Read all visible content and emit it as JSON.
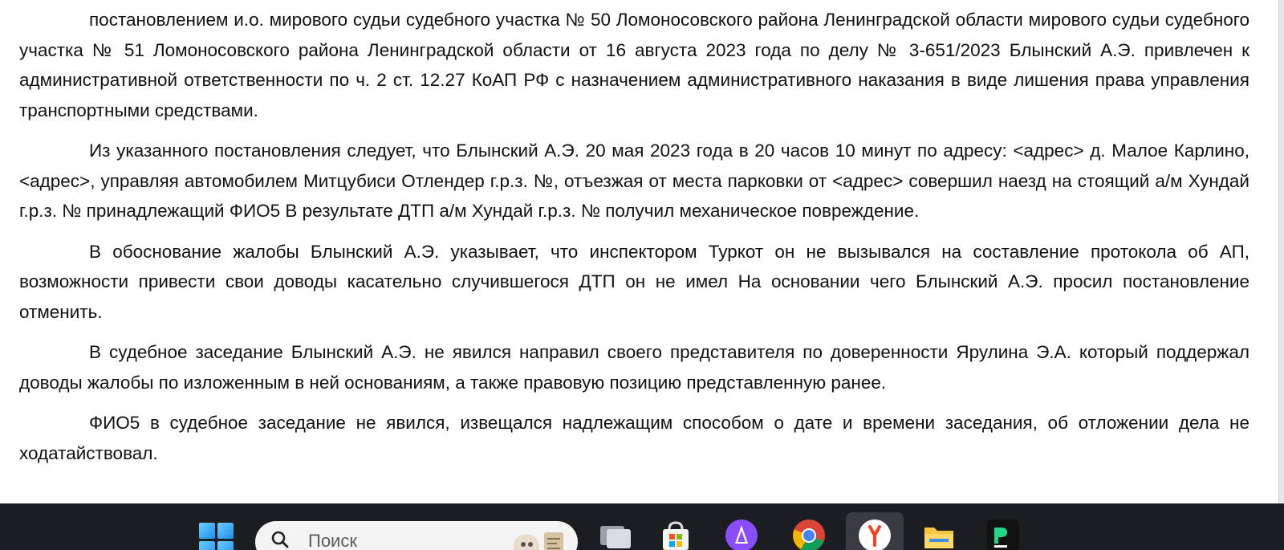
{
  "document": {
    "paragraphs": [
      "постановлением и.о. мирового судьи судебного участка № 50 Ломоносовского района Ленинградской области мирового судьи судебного участка № 51 Ломоносовского района Ленинградской области от 16 августа 2023 года по делу № 3-651/2023 Блынский А.Э. привлечен к административной ответственности по ч. 2 ст. 12.27 КоАП РФ с назначением административного наказания в виде лишения права управления транспортными средствами.",
      "Из указанного постановления следует, что Блынский А.Э. 20 мая 2023 года в 20 часов 10 минут по адресу: <адрес> д. Малое Карлино, <адрес>, управляя автомобилем Митцубиси Отлендер г.р.з. №, отъезжая от места парковки от <адрес> совершил наезд на стоящий а/м Хундай г.р.з. № принадлежащий ФИО5 В результате ДТП а/м Хундай г.р.з. № получил механическое повреждение.",
      "В обоснование жалобы Блынский А.Э. указывает, что инспектором Туркот он не вызывался на составление протокола об АП, возможности привести свои доводы касательно случившегося ДТП он не имел На основании чего Блынский А.Э. просил постановление отменить.",
      "В судебное заседание Блынский А.Э. не явился направил своего представителя по доверенности Ярулина Э.А. который поддержал доводы жалобы по изложенным в ней основаниям, а также правовую позицию представленную ранее.",
      "ФИО5 в судебное заседание не явился, извещался надлежащим способом о дате и времени заседания, об отложении дела не ходатайствовал."
    ]
  },
  "taskbar": {
    "search": {
      "placeholder": "Поиск"
    },
    "icons": [
      "windows-start-icon",
      "search-icon",
      "task-view-icon",
      "microsoft-store-icon",
      "alice-assistant-icon",
      "chrome-icon",
      "yandex-browser-icon",
      "file-explorer-icon",
      "pycharm-icon"
    ],
    "colors": {
      "background": "#1c1d20",
      "search_bg": "#f4f4f4",
      "start_blue": "#1a8ef0",
      "alice_purple": "#8a4dff",
      "explorer_yellow": "#f5c542"
    }
  }
}
